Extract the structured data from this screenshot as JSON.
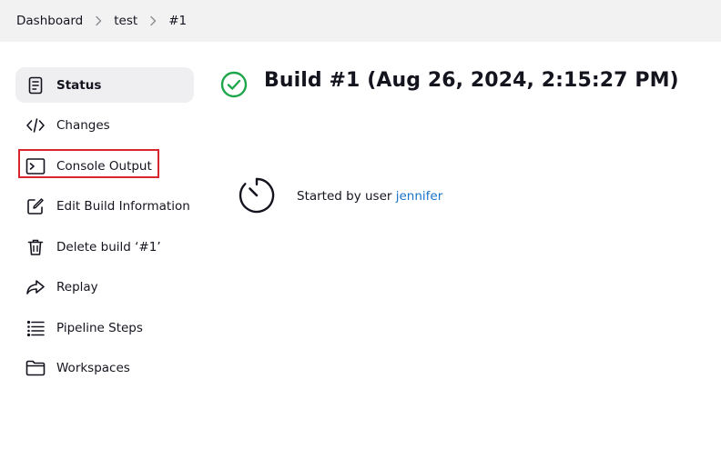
{
  "breadcrumb": {
    "items": [
      "Dashboard",
      "test",
      "#1"
    ]
  },
  "sidebar": {
    "items": [
      {
        "label": "Status",
        "icon": "document-icon",
        "active": true
      },
      {
        "label": "Changes",
        "icon": "code-icon"
      },
      {
        "label": "Console Output",
        "icon": "terminal-icon",
        "highlighted": true
      },
      {
        "label": "Edit Build Information",
        "icon": "edit-icon"
      },
      {
        "label": "Delete build ‘#1’",
        "icon": "trash-icon"
      },
      {
        "label": "Replay",
        "icon": "replay-arrow-icon"
      },
      {
        "label": "Pipeline Steps",
        "icon": "list-steps-icon"
      },
      {
        "label": "Workspaces",
        "icon": "folder-icon"
      }
    ]
  },
  "main": {
    "title": "Build #1 (Aug 26, 2024, 2:15:27 PM)",
    "status_icon": "success-check-icon",
    "cause": {
      "prefix": "Started by user ",
      "user": "jennifer",
      "icon": "timer-icon"
    }
  },
  "colors": {
    "success": "#1ea64b",
    "link": "#1a73c9",
    "highlight_border": "#d9262c",
    "active_bg": "#efeff1",
    "breadcrumb_bg": "#f2f2f3"
  }
}
